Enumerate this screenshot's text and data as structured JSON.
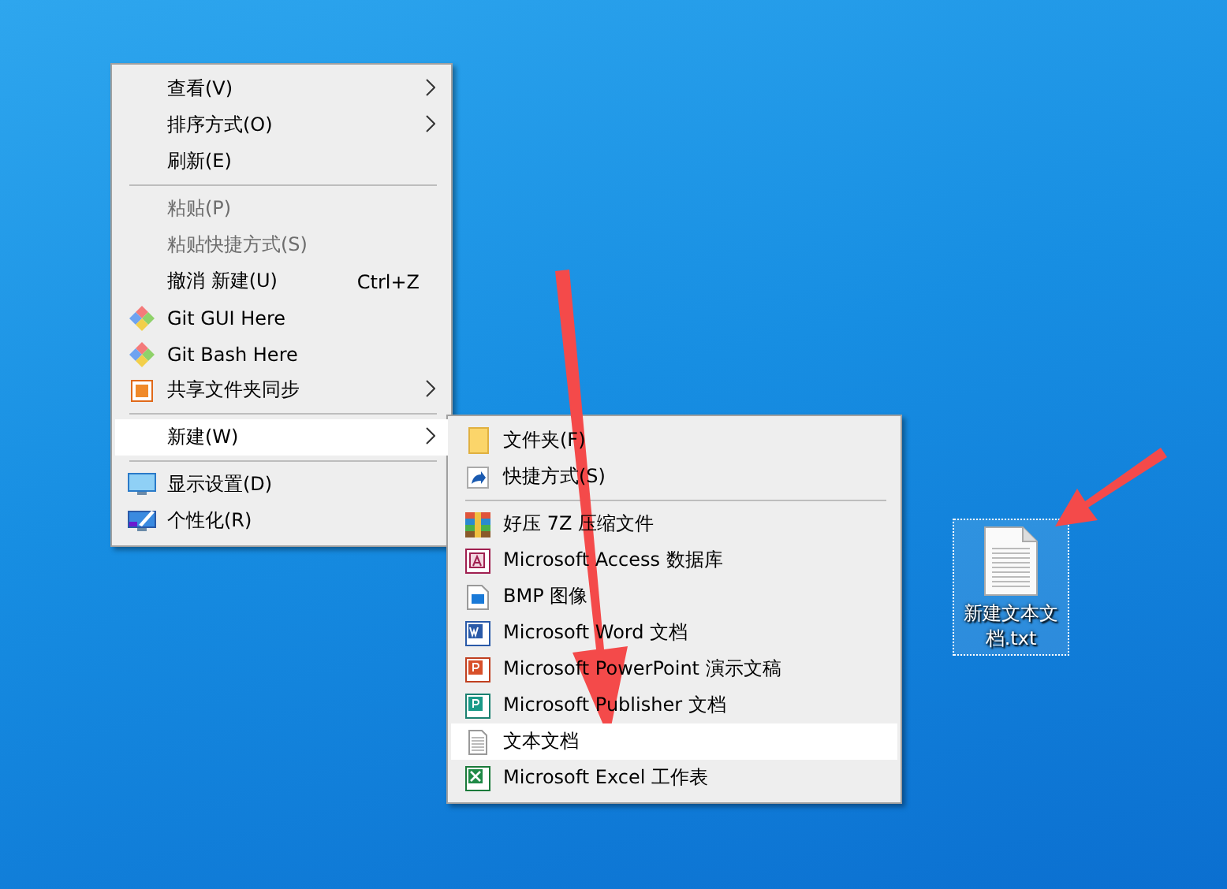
{
  "desktop_menu": {
    "items": [
      {
        "kind": "item",
        "label": "查看(V)",
        "submenu": true,
        "disabled": false,
        "selected": false
      },
      {
        "kind": "item",
        "label": "排序方式(O)",
        "submenu": true,
        "disabled": false,
        "selected": false
      },
      {
        "kind": "item",
        "label": "刷新(E)",
        "submenu": false,
        "disabled": false,
        "selected": false
      },
      {
        "kind": "separator"
      },
      {
        "kind": "item",
        "label": "粘贴(P)",
        "submenu": false,
        "disabled": true,
        "selected": false
      },
      {
        "kind": "item",
        "label": "粘贴快捷方式(S)",
        "submenu": false,
        "disabled": true,
        "selected": false
      },
      {
        "kind": "item",
        "label": "撤消 新建(U)",
        "shortcut": "Ctrl+Z",
        "submenu": false,
        "disabled": false,
        "selected": false
      },
      {
        "kind": "item",
        "label": "Git GUI Here",
        "submenu": false,
        "disabled": false,
        "selected": false
      },
      {
        "kind": "item",
        "label": "Git Bash Here",
        "submenu": false,
        "disabled": false,
        "selected": false
      },
      {
        "kind": "item",
        "label": "共享文件夹同步",
        "submenu": true,
        "disabled": false,
        "selected": false
      },
      {
        "kind": "separator"
      },
      {
        "kind": "item",
        "label": "新建(W)",
        "submenu": true,
        "disabled": false,
        "selected": true
      },
      {
        "kind": "separator"
      },
      {
        "kind": "item",
        "label": "显示设置(D)",
        "submenu": false,
        "disabled": false,
        "selected": false
      },
      {
        "kind": "item",
        "label": "个性化(R)",
        "submenu": false,
        "disabled": false,
        "selected": false
      }
    ]
  },
  "new_submenu": {
    "items": [
      {
        "kind": "item",
        "label": "文件夹(F)",
        "selected": false
      },
      {
        "kind": "item",
        "label": "快捷方式(S)",
        "selected": false
      },
      {
        "kind": "separator"
      },
      {
        "kind": "item",
        "label": "好压 7Z 压缩文件",
        "selected": false
      },
      {
        "kind": "item",
        "label": "Microsoft Access 数据库",
        "selected": false
      },
      {
        "kind": "item",
        "label": "BMP 图像",
        "selected": false
      },
      {
        "kind": "item",
        "label": "Microsoft Word 文档",
        "selected": false
      },
      {
        "kind": "item",
        "label": "Microsoft PowerPoint 演示文稿",
        "selected": false
      },
      {
        "kind": "item",
        "label": "Microsoft Publisher 文档",
        "selected": false
      },
      {
        "kind": "item",
        "label": "文本文档",
        "selected": true
      },
      {
        "kind": "item",
        "label": "Microsoft Excel 工作表",
        "selected": false
      }
    ]
  },
  "desktop_icon": {
    "label": "新建文本文档.txt",
    "selected": true
  }
}
